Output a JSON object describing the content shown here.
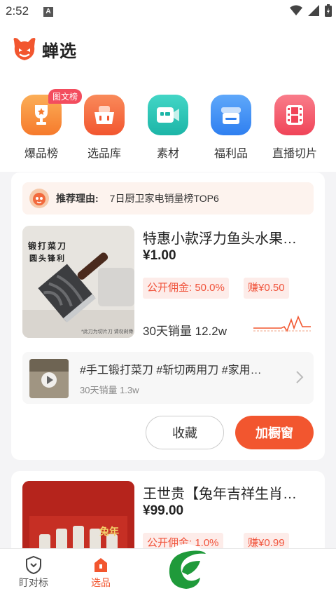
{
  "status": {
    "time": "2:52",
    "notif": "A"
  },
  "app": {
    "logo_text": "蝉选"
  },
  "categories": [
    {
      "label": "爆品榜",
      "badge": "图文榜",
      "color": "#f8913d"
    },
    {
      "label": "选品库",
      "color": "#f56a45"
    },
    {
      "label": "素材",
      "color": "#23c3b5"
    },
    {
      "label": "福利品",
      "color": "#3d8ff2"
    },
    {
      "label": "直播切片",
      "color": "#f25768"
    }
  ],
  "card1": {
    "reason_label": "推荐理由:",
    "reason_text": "7日厨卫家电销量榜TOP6",
    "title": "特惠小款浮力鱼头水果…",
    "price": "¥1.00",
    "commission": "公开佣金: 50.0%",
    "earn": "赚¥0.50",
    "sales": "30天销量 12.2w",
    "image_text_1": "锻打菜刀",
    "image_text_2": "圆头锋利",
    "image_caption": "*此刀为切片刀 请勿剁骨",
    "video_title": "#手工锻打菜刀 #斩切两用刀 #家用…",
    "video_sales": "30天销量 1.3w",
    "collect_label": "收藏",
    "add_label": "加橱窗"
  },
  "card2": {
    "title": "王世贵【兔年吉祥生肖…",
    "price": "¥99.00",
    "commission": "公开佣金: 1.0%",
    "earn": "赚¥0.99",
    "image_text": "兔年"
  },
  "nav": {
    "items": [
      {
        "label": "盯对标",
        "icon": "shield-icon"
      },
      {
        "label": "选品",
        "icon": "home-icon",
        "active": true
      }
    ]
  },
  "colors": {
    "accent": "#f2562f",
    "tag_bg": "#fdece9",
    "tag_text": "#f0533b"
  }
}
